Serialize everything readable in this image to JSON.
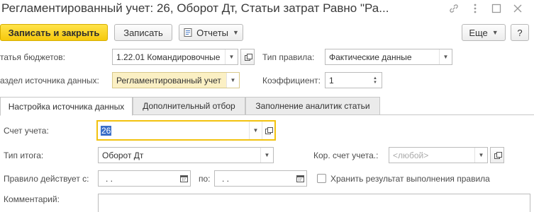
{
  "window": {
    "title": "Регламентированный учет: 26, Оборот Дт, Статьи затрат Равно \"Ра...",
    "icons": [
      "link-icon",
      "more-icon",
      "maximize-icon",
      "close-icon"
    ]
  },
  "toolbar": {
    "save_close": "Записать и закрыть",
    "save": "Записать",
    "reports": "Отчеты",
    "more": "Еще",
    "help": "?"
  },
  "form": {
    "budget_item_label": "татья бюджетов:",
    "budget_item_value": "1.22.01 Командировочные",
    "rule_type_label": "Тип правила:",
    "rule_type_value": "Фактические данные",
    "data_source_label": "аздел источника данных:",
    "data_source_value": "Регламентированный учет",
    "coefficient_label": "Коэффициент:",
    "coefficient_value": "1"
  },
  "tabs": [
    {
      "label": "Настройка источника данных",
      "active": true
    },
    {
      "label": "Дополнительный отбор",
      "active": false
    },
    {
      "label": "Заполнение аналитик статьи",
      "active": false
    }
  ],
  "source": {
    "account_label": "Счет учета:",
    "account_value": "26",
    "total_type_label": "Тип итога:",
    "total_type_value": "Оборот Дт",
    "corr_account_label": "Кор. счет учета.:",
    "corr_account_placeholder": "<любой>",
    "valid_from_label": "Правило действует с:",
    "valid_from_value": ".  .",
    "valid_to_label": "по:",
    "valid_to_value": ".  .",
    "store_result_label": "Хранить результат выполнения правила",
    "store_result_checked": false,
    "comment_label": "Комментарий:",
    "comment_value": ""
  },
  "colors": {
    "primary_button": "#f6c90c",
    "highlight_field": "#fbf0c4",
    "focus_border": "#f2c20f",
    "selection": "#3a6ec8"
  }
}
